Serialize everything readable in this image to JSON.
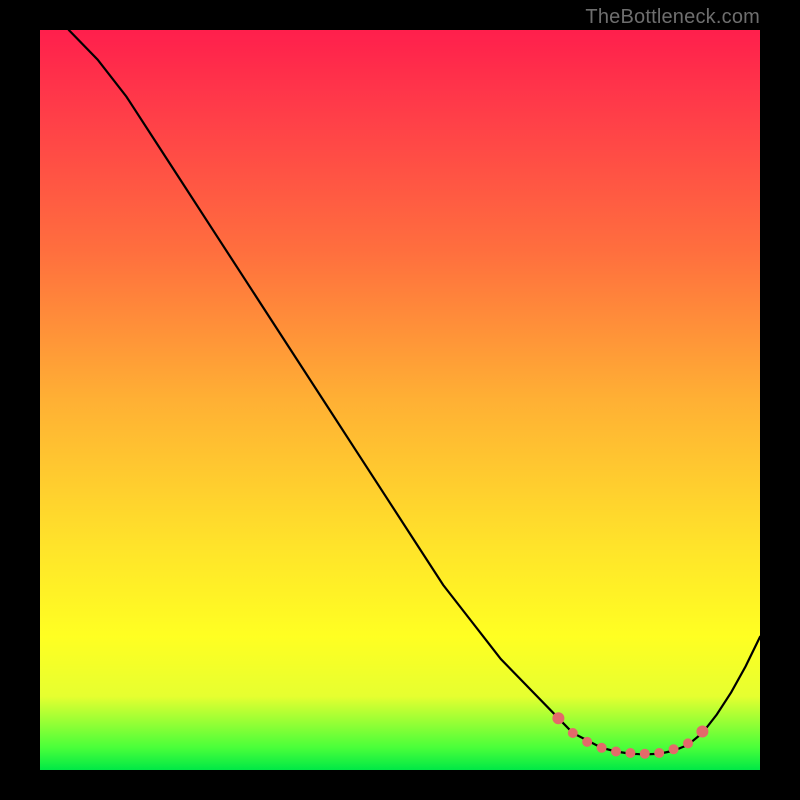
{
  "attribution": "TheBottleneck.com",
  "chart_data": {
    "type": "line",
    "title": "",
    "xlabel": "",
    "ylabel": "",
    "xlim": [
      0,
      100
    ],
    "ylim": [
      0,
      100
    ],
    "series": [
      {
        "name": "curve",
        "x": [
          4,
          8,
          12,
          16,
          20,
          24,
          28,
          32,
          36,
          40,
          44,
          48,
          52,
          56,
          60,
          64,
          68,
          72,
          74,
          76,
          78,
          80,
          82,
          84,
          86,
          88,
          90,
          92,
          94,
          96,
          98,
          100
        ],
        "y": [
          100,
          96,
          91,
          85,
          79,
          73,
          67,
          61,
          55,
          49,
          43,
          37,
          31,
          25,
          20,
          15,
          11,
          7,
          5,
          4,
          3,
          2.5,
          2.2,
          2.1,
          2.2,
          2.6,
          3.4,
          5,
          7.5,
          10.5,
          14,
          18
        ]
      },
      {
        "name": "dots",
        "x": [
          72,
          74,
          76,
          78,
          80,
          82,
          84,
          86,
          88,
          90,
          92
        ],
        "y": [
          7,
          5,
          3.8,
          3.0,
          2.5,
          2.3,
          2.2,
          2.3,
          2.8,
          3.6,
          5.2
        ]
      }
    ],
    "colors": {
      "curve": "#000000",
      "dots": "#e36a6a"
    }
  }
}
